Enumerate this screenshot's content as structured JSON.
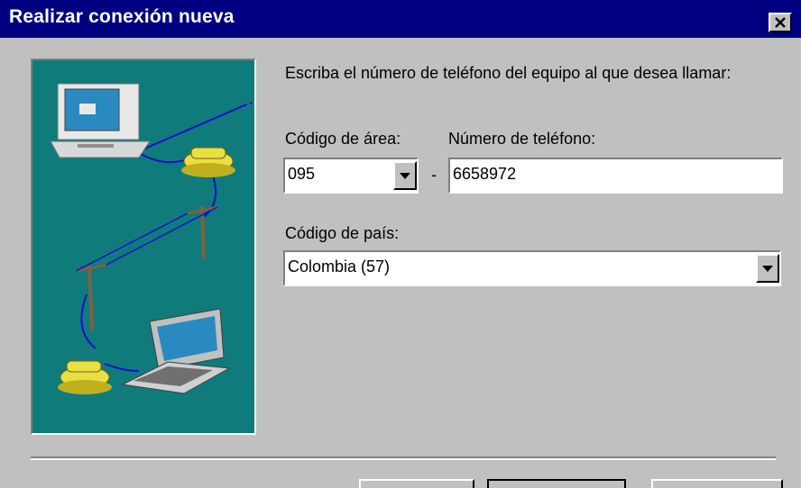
{
  "window": {
    "title": "Realizar conexión nueva",
    "close_icon": "close-x-icon"
  },
  "dialog": {
    "intro": "Escriba el número de teléfono del equipo al que desea llamar:",
    "area_code": {
      "label": "Código de área:",
      "value": "095"
    },
    "separator": "-",
    "phone_number": {
      "label": "Número de teléfono:",
      "value": "6658972"
    },
    "country_code": {
      "label": "Código de país:",
      "value": "Colombia (57)"
    }
  },
  "illustration": {
    "description_icons": [
      "computer-icon",
      "telephone-icon",
      "utility-pole-icon",
      "laptop-icon"
    ]
  },
  "colors": {
    "titlebar": "#000080",
    "window_bg": "#c0c0c0",
    "illustration_bg": "#0f7b7b"
  }
}
